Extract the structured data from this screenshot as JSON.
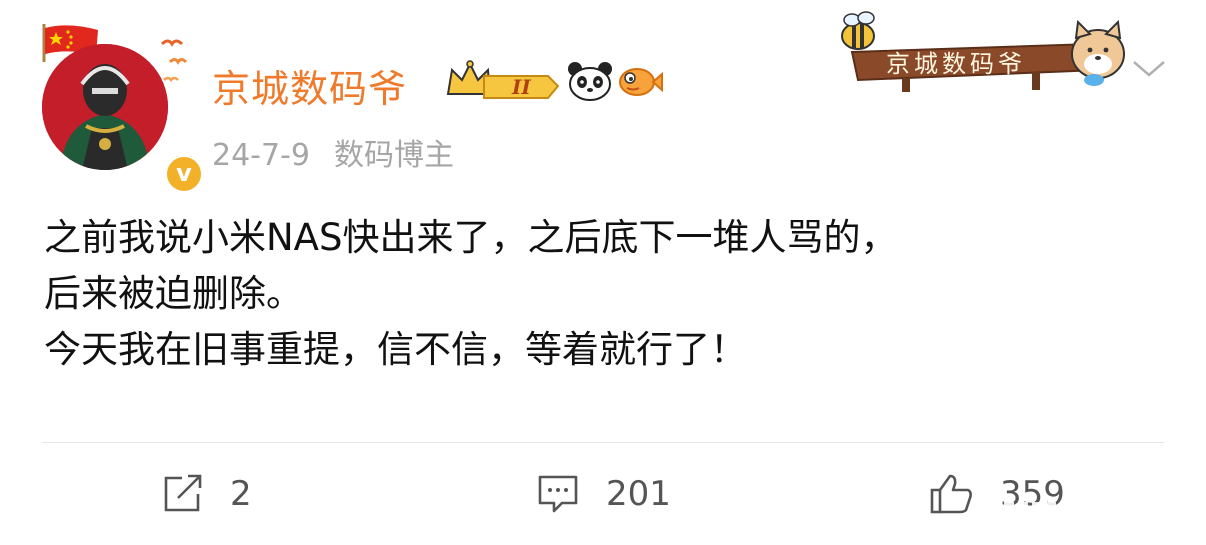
{
  "post": {
    "author": "京城数码爷",
    "badge_level": "II",
    "date": "24-7-9",
    "source": "数码博主",
    "verified_mark": "v",
    "content_lines": [
      "之前我说小米NAS快出来了，之后底下一堆人骂的，",
      "后来被迫删除。",
      "今天我在旧事重提，信不信，等着就行了！"
    ],
    "sign_text": "京城数码爷"
  },
  "actions": {
    "repost_count": "2",
    "comment_count": "201",
    "like_count": "359"
  },
  "colors": {
    "username": "#f07a2c",
    "meta": "#a6a6a6",
    "divider": "#e6e6e6",
    "verified": "#f3b12a"
  },
  "icons": {
    "repost": "repost-icon",
    "comment": "comment-icon",
    "like": "thumbs-up-icon",
    "menu": "chevron-down-icon"
  }
}
